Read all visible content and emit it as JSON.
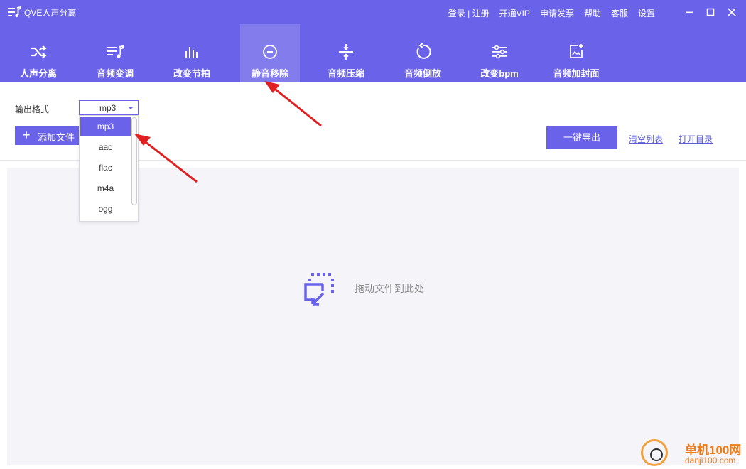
{
  "app": {
    "title": "QVE人声分离",
    "top_links": [
      "登录 | 注册",
      "开通VIP",
      "申请发票",
      "帮助",
      "客服",
      "设置"
    ],
    "window_controls": [
      "minimize-icon",
      "maximize-icon",
      "close-icon"
    ]
  },
  "tabs": [
    {
      "label": "人声分离",
      "icon": "shuffle-icon"
    },
    {
      "label": "音频变调",
      "icon": "music-list-icon"
    },
    {
      "label": "改变节拍",
      "icon": "beat-bars-icon"
    },
    {
      "label": "静音移除",
      "icon": "minus-circle-icon",
      "active": true
    },
    {
      "label": "音频压缩",
      "icon": "compress-icon"
    },
    {
      "label": "音频倒放",
      "icon": "rewind-icon"
    },
    {
      "label": "改变bpm",
      "icon": "sliders-icon"
    },
    {
      "label": "音频加封面",
      "icon": "image-add-icon"
    }
  ],
  "toolbar": {
    "format_label": "输出格式",
    "format_value": "mp3",
    "add_file_label": "添加文件",
    "export_label": "一键导出",
    "clear_label": "清空列表",
    "open_dir_label": "打开目录"
  },
  "dropdown": {
    "options": [
      "mp3",
      "aac",
      "flac",
      "m4a",
      "ogg"
    ],
    "selected": "mp3"
  },
  "dropzone": {
    "text": "拖动文件到此处"
  },
  "watermark": {
    "name": "单机100网",
    "url": "danji100.com"
  },
  "colors": {
    "accent": "#6a63ea",
    "link": "#5b5bd6",
    "annotation_arrow": "#e02020",
    "watermark": "#ee7a16"
  }
}
